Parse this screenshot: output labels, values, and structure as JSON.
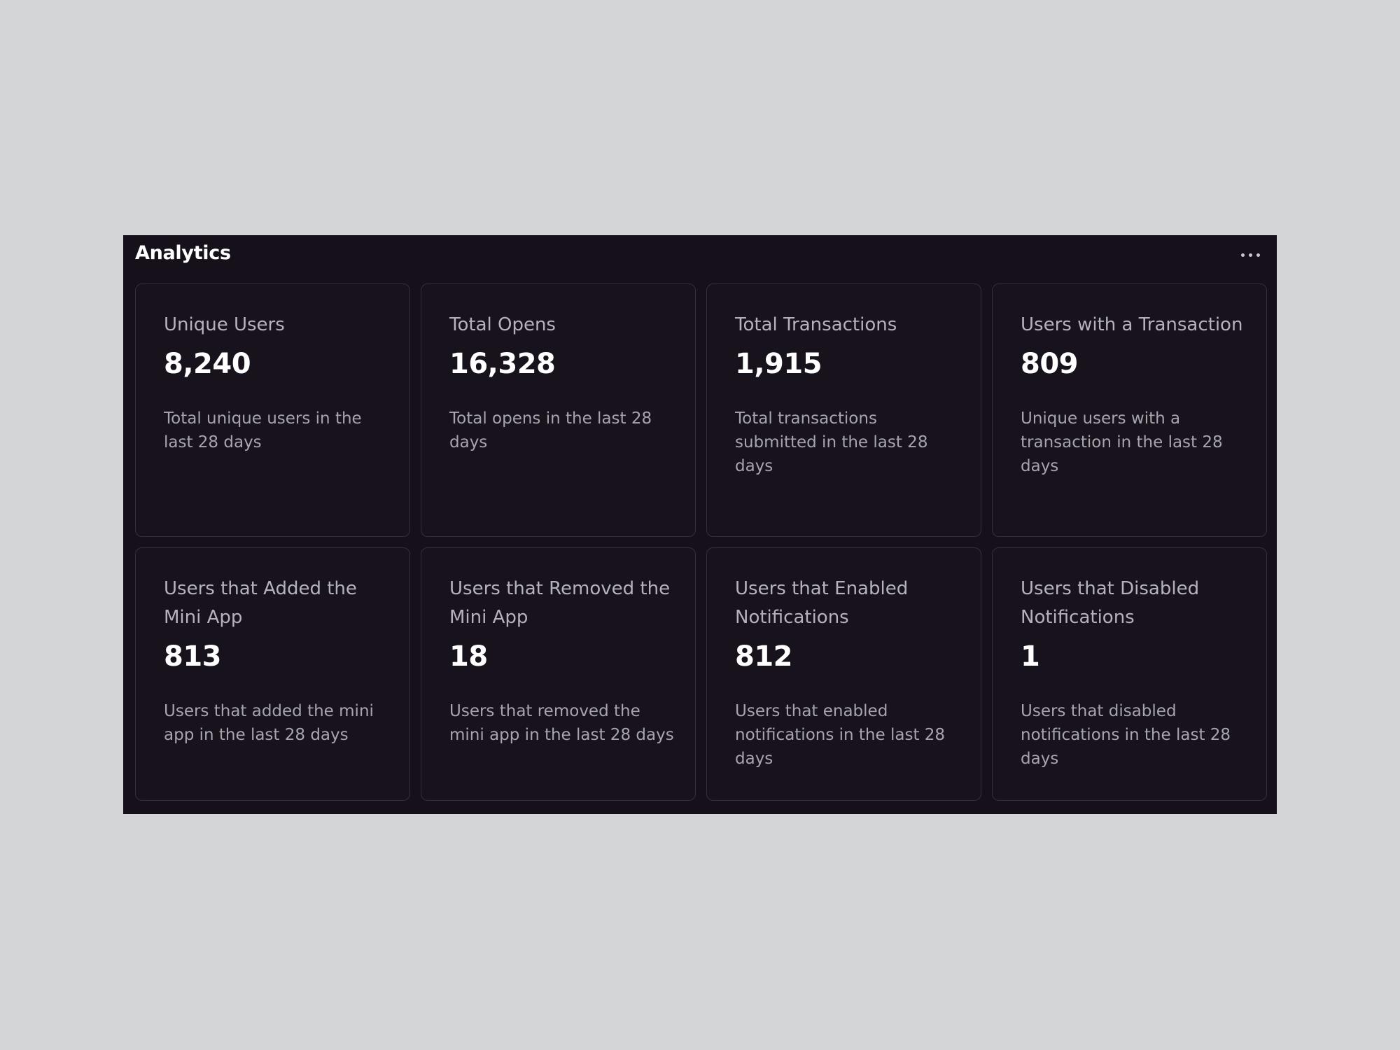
{
  "panel": {
    "title": "Analytics",
    "menu_icon": "more-horizontal-icon"
  },
  "cards": [
    {
      "label": "Unique Users",
      "value": "8,240",
      "description": "Total unique users in the last 28 days"
    },
    {
      "label": "Total Opens",
      "value": "16,328",
      "description": "Total opens in the last 28 days"
    },
    {
      "label": "Total Transactions",
      "value": "1,915",
      "description": "Total transactions submitted in the last 28 days"
    },
    {
      "label": "Users with a Transaction",
      "value": "809",
      "description": "Unique users with a transaction in the last 28 days"
    },
    {
      "label": "Users that Added the Mini App",
      "value": "813",
      "description": "Users that added the mini app in the last 28 days"
    },
    {
      "label": "Users that Removed the Mini App",
      "value": "18",
      "description": "Users that removed the mini app in the last 28 days"
    },
    {
      "label": "Users that Enabled Notifications",
      "value": "812",
      "description": "Users that enabled notifications in the last 28 days"
    },
    {
      "label": "Users that Disabled Notifications",
      "value": "1",
      "description": "Users that disabled notifications in the last 28 days"
    }
  ],
  "colors": {
    "page_background": "#d4d5d7",
    "panel_background": "#151019",
    "card_border": "#34303a",
    "value_text": "#ffffff",
    "label_text": "#b6b2bc"
  }
}
